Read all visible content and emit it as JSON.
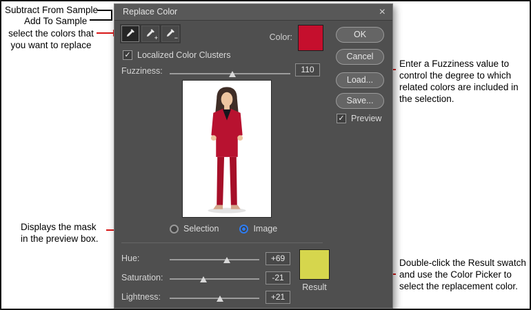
{
  "window": {
    "title": "Replace Color",
    "close_glyph": "×"
  },
  "sample_tools": {
    "droppers": [
      {
        "name": "eyedropper",
        "modifier": ""
      },
      {
        "name": "add-to-sample-eyedropper",
        "modifier": "+"
      },
      {
        "name": "subtract-from-sample-eyedropper",
        "modifier": "−"
      }
    ]
  },
  "color_section": {
    "label": "Color:",
    "swatch_color": "#c50f2d"
  },
  "localized": {
    "label": "Localized Color Clusters",
    "check_glyph": "✓"
  },
  "fuzziness": {
    "label": "Fuzziness:",
    "value": "110",
    "thumb_pos": "52%"
  },
  "action_buttons": [
    {
      "label": "OK"
    },
    {
      "label": "Cancel"
    },
    {
      "label": "Load..."
    },
    {
      "label": "Save..."
    }
  ],
  "preview_check": {
    "label": "Preview",
    "check_glyph": "✓"
  },
  "display_mode": {
    "selection_label": "Selection",
    "image_label": "Image"
  },
  "adjustments": [
    {
      "label": "Hue:",
      "value": "+69",
      "thumb_pos": "64%"
    },
    {
      "label": "Saturation:",
      "value": "-21",
      "thumb_pos": "38%"
    },
    {
      "label": "Lightness:",
      "value": "+21",
      "thumb_pos": "56%"
    }
  ],
  "result": {
    "label": "Result",
    "swatch_color": "#d6d64d"
  },
  "colors": {
    "accent_blue": "#2e7cf0",
    "annotation_arrow": "#d81616"
  },
  "annotations": {
    "subtract_label": "Subtract From Sample",
    "add_label": "Add To Sample",
    "select_note": "select the colors that\nyou want to replace",
    "fuzziness_note": "Enter a Fuzziness value to control the degree to which related colors are included in the selection.",
    "mask_note": "Displays the mask\nin the preview box.",
    "result_note": "Double-click the Result swatch and use the Color Picker to select the replacement color."
  }
}
